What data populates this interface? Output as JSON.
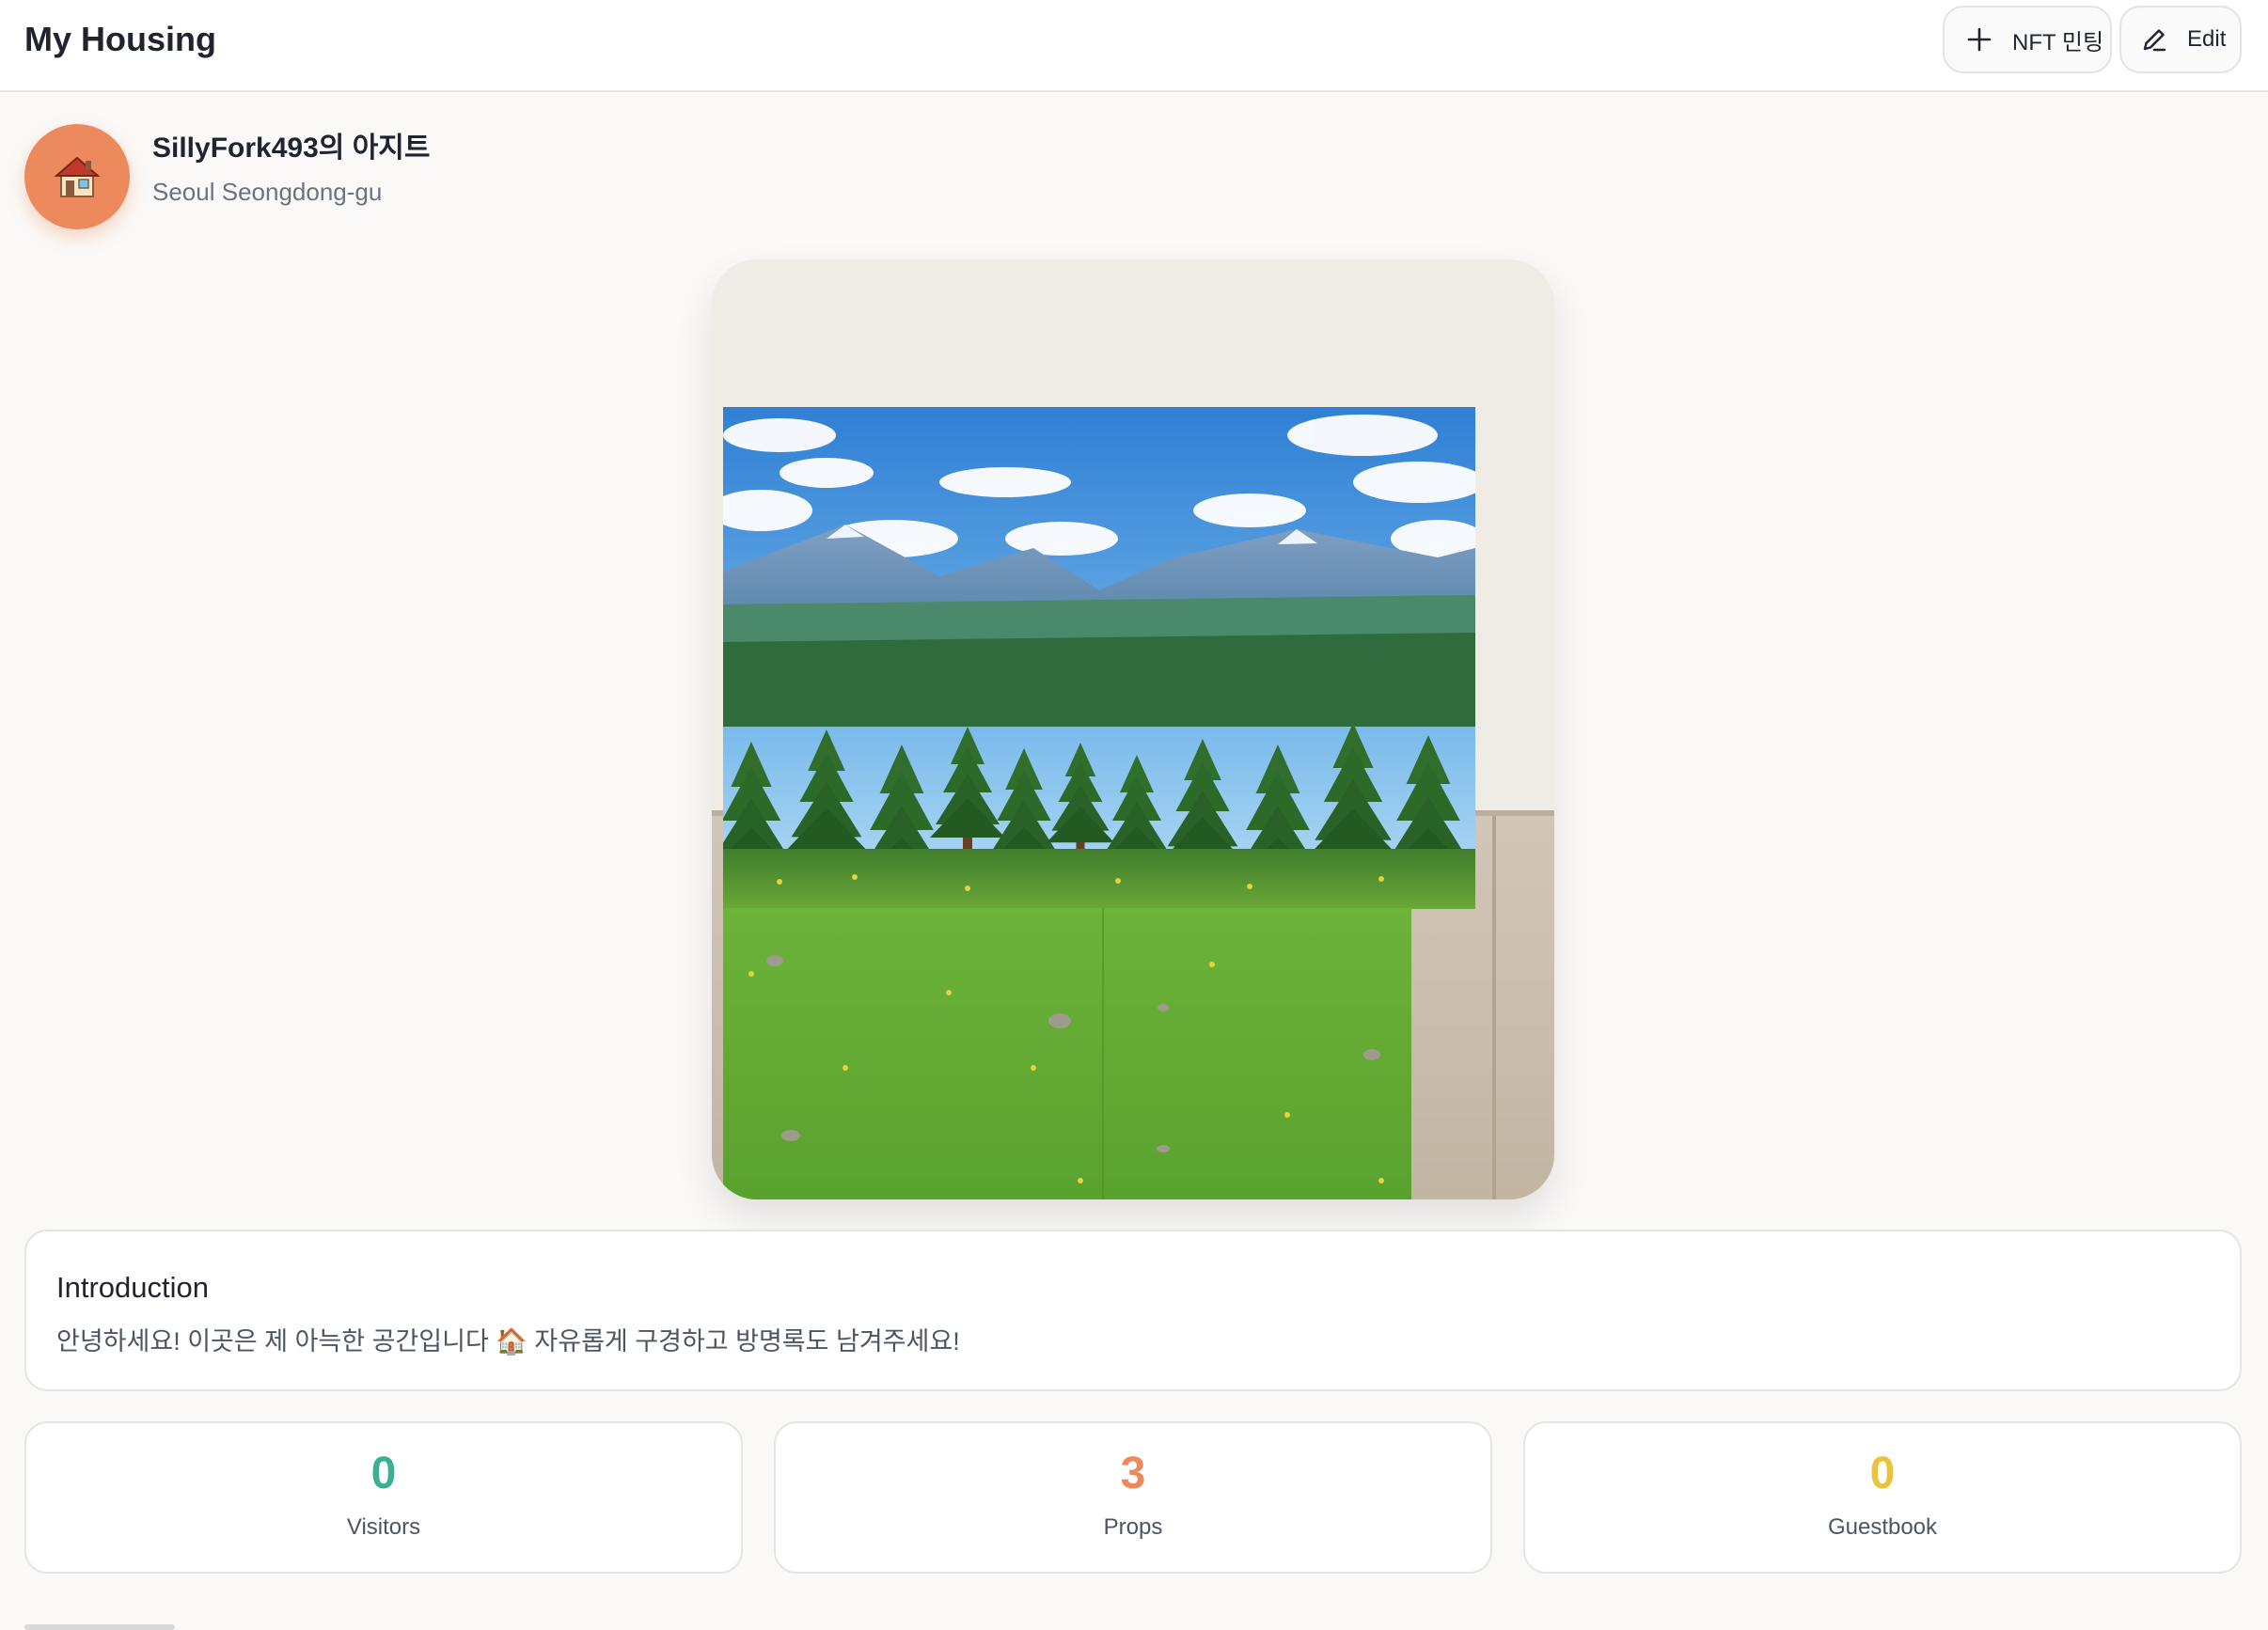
{
  "header": {
    "title": "My Housing",
    "mint_button_label": "NFT 민팅",
    "edit_button_label": "Edit",
    "mint_icon": "plus-icon",
    "edit_icon": "pencil-icon"
  },
  "profile": {
    "avatar_icon": "house-emoji-icon",
    "avatar_glyph": "🏠",
    "avatar_color": "#ec8a5e",
    "name": "SillyFork493의 아지트",
    "location": "Seoul Seongdong-gu"
  },
  "room": {
    "scene": "pixel-art forest background with mountains, pine trees and grass floor"
  },
  "introduction": {
    "title": "Introduction",
    "text": "안녕하세요! 이곳은 제 아늑한 공간입니다 🏠 자유롭게 구경하고 방명록도 남겨주세요!"
  },
  "stats": [
    {
      "value": "0",
      "label": "Visitors",
      "color": "#3bb092"
    },
    {
      "value": "3",
      "label": "Props",
      "color": "#ec8a5e"
    },
    {
      "value": "0",
      "label": "Guestbook",
      "color": "#ebc23c"
    }
  ],
  "colors": {
    "accent_orange": "#ec8a5e",
    "accent_green": "#3bb092",
    "accent_yellow": "#ebc23c"
  }
}
